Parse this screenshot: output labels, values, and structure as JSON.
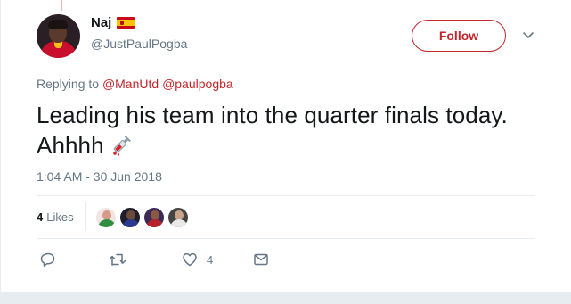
{
  "tweet": {
    "author": {
      "display_name": "Naj",
      "handle": "@JustPaulPogba",
      "flag_icon": "spain-flag-icon"
    },
    "follow_label": "Follow",
    "replying_prefix": "Replying to",
    "replying_to": [
      "@ManUtd",
      "@paulpogba"
    ],
    "text": "Leading his team into the quarter finals today. Ahhhh",
    "text_emoji_icon": "syringe-icon",
    "timestamp": "1:04 AM - 30 Jun 2018",
    "likes": {
      "count": "4",
      "label": "Likes"
    },
    "actions": {
      "reply_icon": "reply-icon",
      "retweet_icon": "retweet-icon",
      "like_icon": "heart-icon",
      "like_count": "4",
      "dm_icon": "envelope-icon"
    }
  },
  "colors": {
    "accent": "#c4252b",
    "muted": "#657786",
    "text": "#14171a"
  }
}
